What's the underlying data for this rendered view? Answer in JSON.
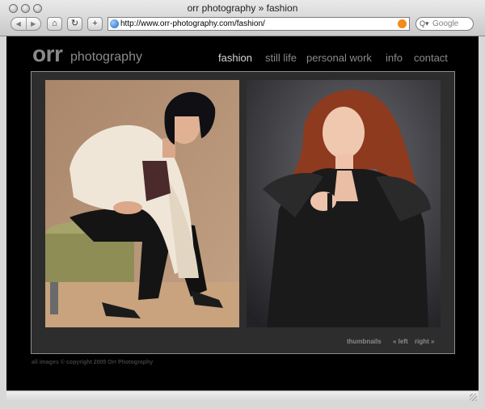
{
  "window": {
    "title": "orr photography » fashion",
    "url": "http://www.orr-photography.com/fashion/",
    "search_placeholder": "Google"
  },
  "toolbar": {
    "back_icon": "back-arrow-icon",
    "forward_icon": "forward-arrow-icon",
    "home_icon": "home-icon",
    "reload_icon": "reload-icon",
    "add_icon": "plus-icon"
  },
  "site": {
    "logo_main": "orr",
    "logo_sub": "photography",
    "nav": [
      "fashion",
      "still life",
      "personal work",
      "info",
      "contact"
    ],
    "active_nav": "fashion",
    "pager": {
      "thumbnails": "thumbnails",
      "left": "« left",
      "right": "right »"
    },
    "copyright": "all images © copyright 2005 Orr Photography"
  },
  "colors": {
    "page_bg": "#000000",
    "panel_bg": "#2d2d2d",
    "text_dim": "#8a8a8a",
    "text_active": "#d6d6d6"
  }
}
